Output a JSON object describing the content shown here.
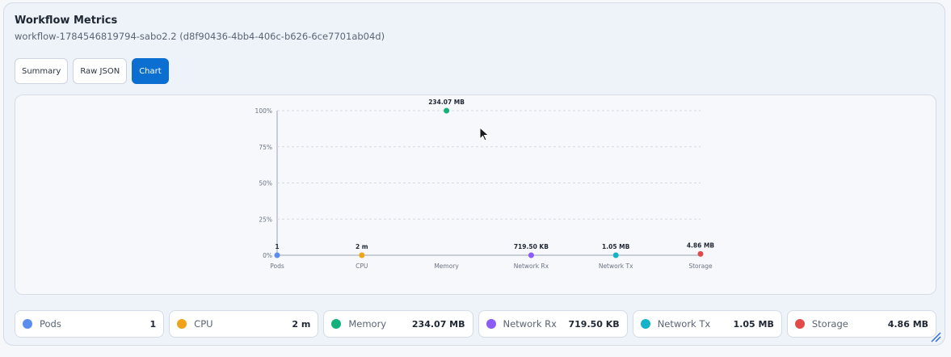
{
  "header": {
    "title": "Workflow Metrics",
    "subtitle": "workflow-1784546819794-sabo2.2 (d8f90436-4bb4-406c-b626-6ce7701ab04d)"
  },
  "tabs": [
    {
      "label": "Summary",
      "active": false
    },
    {
      "label": "Raw JSON",
      "active": false
    },
    {
      "label": "Chart",
      "active": true
    }
  ],
  "chart_data": {
    "type": "scatter",
    "categories": [
      "Pods",
      "CPU",
      "Memory",
      "Network Rx",
      "Network Tx",
      "Storage"
    ],
    "values_percent": [
      0,
      0,
      100,
      0,
      0,
      0.9
    ],
    "data_labels": [
      "1",
      "2 m",
      "234.07 MB",
      "719.50 KB",
      "1.05 MB",
      "4.86 MB"
    ],
    "colors": [
      "#5b8def",
      "#f0a31a",
      "#14b07a",
      "#8b5cf6",
      "#15b3c8",
      "#e04a4a"
    ],
    "y_ticks": [
      "0%",
      "25%",
      "50%",
      "75%",
      "100%"
    ],
    "ylim": [
      0,
      100
    ],
    "grid": true
  },
  "legend": [
    {
      "name": "Pods",
      "value": "1",
      "color": "#5b8def"
    },
    {
      "name": "CPU",
      "value": "2 m",
      "color": "#f0a31a"
    },
    {
      "name": "Memory",
      "value": "234.07 MB",
      "color": "#14b07a"
    },
    {
      "name": "Network Rx",
      "value": "719.50 KB",
      "color": "#8b5cf6"
    },
    {
      "name": "Network Tx",
      "value": "1.05 MB",
      "color": "#15b3c8"
    },
    {
      "name": "Storage",
      "value": "4.86 MB",
      "color": "#e04a4a"
    }
  ],
  "icons": {
    "cursor": "mouse-pointer-icon",
    "resize": "resize-handle-icon"
  }
}
